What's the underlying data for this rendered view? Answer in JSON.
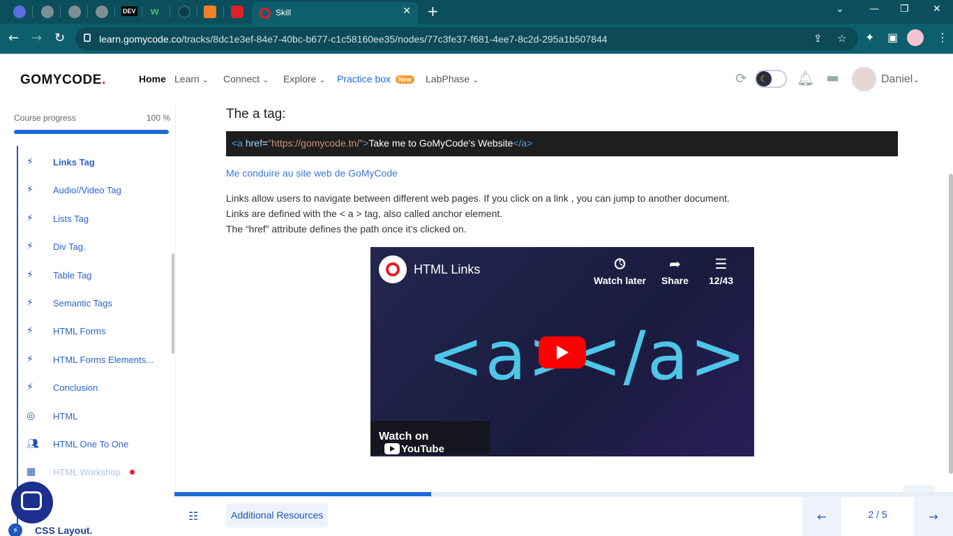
{
  "browser": {
    "active_tab_title": "Skill",
    "dev_tab_label": "DEV",
    "url_host": "learn.gomycode.co",
    "url_path": "/tracks/8dc1e3ef-84e7-40bc-b677-c1c58160ee35/nodes/77c3fe37-f681-4ee7-8c2d-295a1b507844"
  },
  "header": {
    "logo": "GOMYCODE",
    "logo_mark": ".",
    "nav": {
      "home": "Home",
      "learn": "Learn",
      "connect": "Connect",
      "explore": "Explore",
      "practice_box": "Practice box",
      "practice_badge": "New",
      "labphase": "LabPhase"
    },
    "username": "Daniel"
  },
  "sidebar": {
    "progress_label": "Course progress",
    "progress_value": "100 %",
    "progress_fraction": 1.0,
    "items": [
      {
        "label": "Links Tag",
        "icon": "bolt-icon",
        "current": true
      },
      {
        "label": "Audio//Video Tag",
        "icon": "bolt-icon"
      },
      {
        "label": "Lists Tag",
        "icon": "bolt-icon"
      },
      {
        "label": "Div Tag.",
        "icon": "bolt-icon"
      },
      {
        "label": "Table Tag",
        "icon": "bolt-icon"
      },
      {
        "label": "Semantic Tags",
        "icon": "bolt-icon"
      },
      {
        "label": "HTML Forms",
        "icon": "bolt-icon"
      },
      {
        "label": "HTML Forms Elements...",
        "icon": "bolt-icon"
      },
      {
        "label": "Conclusion",
        "icon": "bolt-icon"
      },
      {
        "label": "HTML",
        "icon": "target-icon"
      },
      {
        "label": "HTML One To One",
        "icon": "people-icon"
      },
      {
        "label": "HTML Workshop",
        "icon": "workshop-icon",
        "muted": true
      }
    ],
    "next_section": "CSS Layout."
  },
  "content": {
    "heading": "The a tag:",
    "code": {
      "open_tag": "<a",
      "attr": "href",
      "equals": "=",
      "value": "\"https://gomycode.tn/\"",
      "close_bracket": ">",
      "text": "Take me to GoMyCode's Website",
      "end_tag": "</a>"
    },
    "rendered_link": "Me conduire au site web de GoMyCode",
    "paragraphs": [
      "Links allow users to navigate between different web pages. If you click on a link , you can jump to another document.",
      "Links are defined with the < a > tag, also called anchor element.",
      "The “href” attribute defines the path once it’s clicked on."
    ],
    "video": {
      "title": "HTML Links",
      "watch_later": "Watch later",
      "share": "Share",
      "playlist": "12/43",
      "watch_on": "Watch on",
      "youtube": "YouTube",
      "thumb_open": "<a>",
      "thumb_close": "</a>"
    }
  },
  "footer": {
    "lesson_progress_fraction": 0.33,
    "resources_button": "Additional Resources",
    "page": "2 / 5"
  },
  "colors": {
    "brand_blue": "#1f6bd6",
    "brand_red": "#e0202a",
    "browser_teal": "#0e5f6e"
  }
}
